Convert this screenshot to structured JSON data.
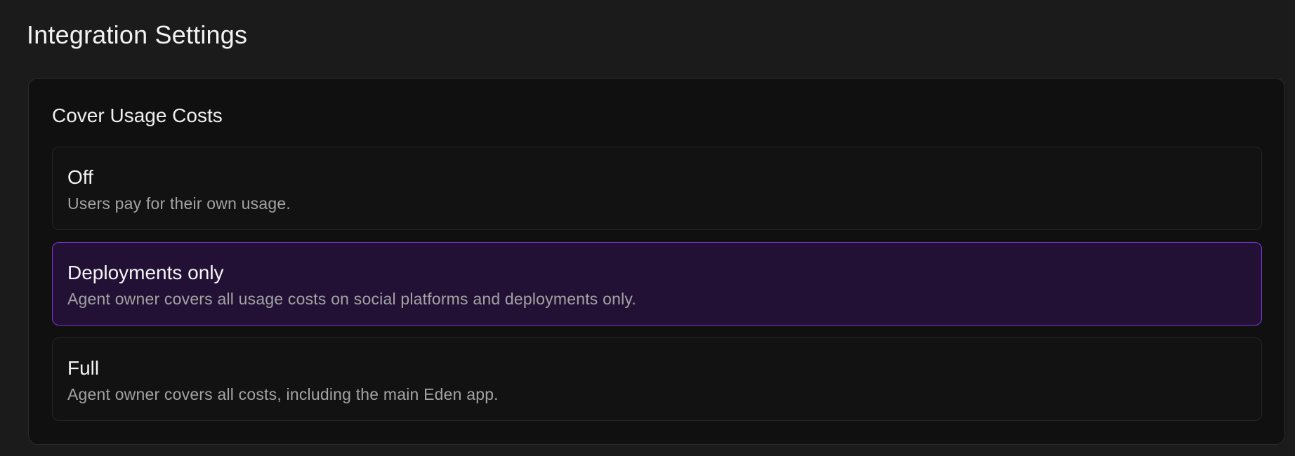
{
  "page": {
    "title": "Integration Settings"
  },
  "cover_usage": {
    "section_title": "Cover Usage Costs",
    "selected": "deployments_only",
    "options": [
      {
        "key": "off",
        "title": "Off",
        "description": "Users pay for their own usage."
      },
      {
        "key": "deployments_only",
        "title": "Deployments only",
        "description": "Agent owner covers all usage costs on social platforms and deployments only."
      },
      {
        "key": "full",
        "title": "Full",
        "description": "Agent owner covers all costs, including the main Eden app."
      }
    ]
  },
  "colors": {
    "page_background": "#1b1b1b",
    "panel_background": "#101010",
    "selected_background": "#221135",
    "selected_border": "#7d36d9",
    "muted_text": "#a3a3a3"
  }
}
